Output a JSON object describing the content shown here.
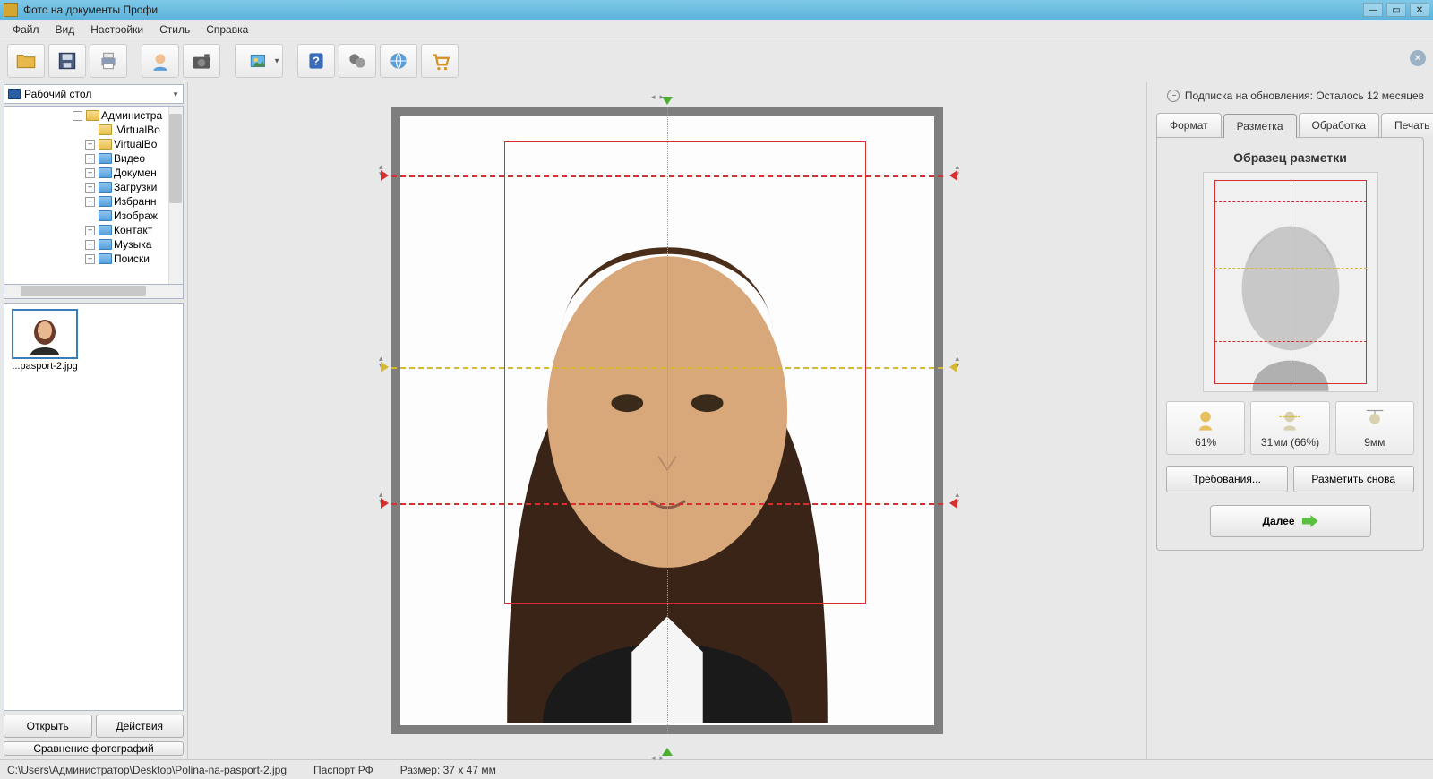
{
  "window": {
    "title": "Фото на документы Профи"
  },
  "menu": {
    "file": "Файл",
    "view": "Вид",
    "settings": "Настройки",
    "style": "Стиль",
    "help": "Справка"
  },
  "subscription": {
    "text": "Подписка на обновления: Осталось 12 месяцев"
  },
  "sidebar": {
    "location": "Рабочий стол",
    "tree": [
      {
        "label": "Администра",
        "expand": "-",
        "indent": 1,
        "color": ""
      },
      {
        "label": ".VirtualBo",
        "expand": "",
        "indent": 2,
        "color": ""
      },
      {
        "label": "VirtualBo",
        "expand": "+",
        "indent": 2,
        "color": ""
      },
      {
        "label": "Видео",
        "expand": "+",
        "indent": 2,
        "color": "blue"
      },
      {
        "label": "Докумен",
        "expand": "+",
        "indent": 2,
        "color": "blue"
      },
      {
        "label": "Загрузки",
        "expand": "+",
        "indent": 2,
        "color": "blue"
      },
      {
        "label": "Избранн",
        "expand": "+",
        "indent": 2,
        "color": "blue"
      },
      {
        "label": "Изображ",
        "expand": "",
        "indent": 2,
        "color": "blue"
      },
      {
        "label": "Контакт",
        "expand": "+",
        "indent": 2,
        "color": "blue"
      },
      {
        "label": "Музыка",
        "expand": "+",
        "indent": 2,
        "color": "blue"
      },
      {
        "label": "Поиски",
        "expand": "+",
        "indent": 2,
        "color": "blue"
      }
    ],
    "thumb_label": "...pasport-2.jpg",
    "open_btn": "Открыть",
    "actions_btn": "Действия",
    "compare_btn": "Сравнение фотографий"
  },
  "tabs": {
    "format": "Формат",
    "markup": "Разметка",
    "processing": "Обработка",
    "print": "Печать"
  },
  "panel": {
    "sample_title": "Образец разметки",
    "metric1": "61%",
    "metric2": "31мм (66%)",
    "metric3": "9мм",
    "requirements_btn": "Требования...",
    "remark_btn": "Разметить снова",
    "next_btn": "Далее"
  },
  "status": {
    "path": "C:\\Users\\Администратор\\Desktop\\Polina-na-pasport-2.jpg",
    "doc_type": "Паспорт РФ",
    "size": "Размер: 37 x 47 мм"
  }
}
